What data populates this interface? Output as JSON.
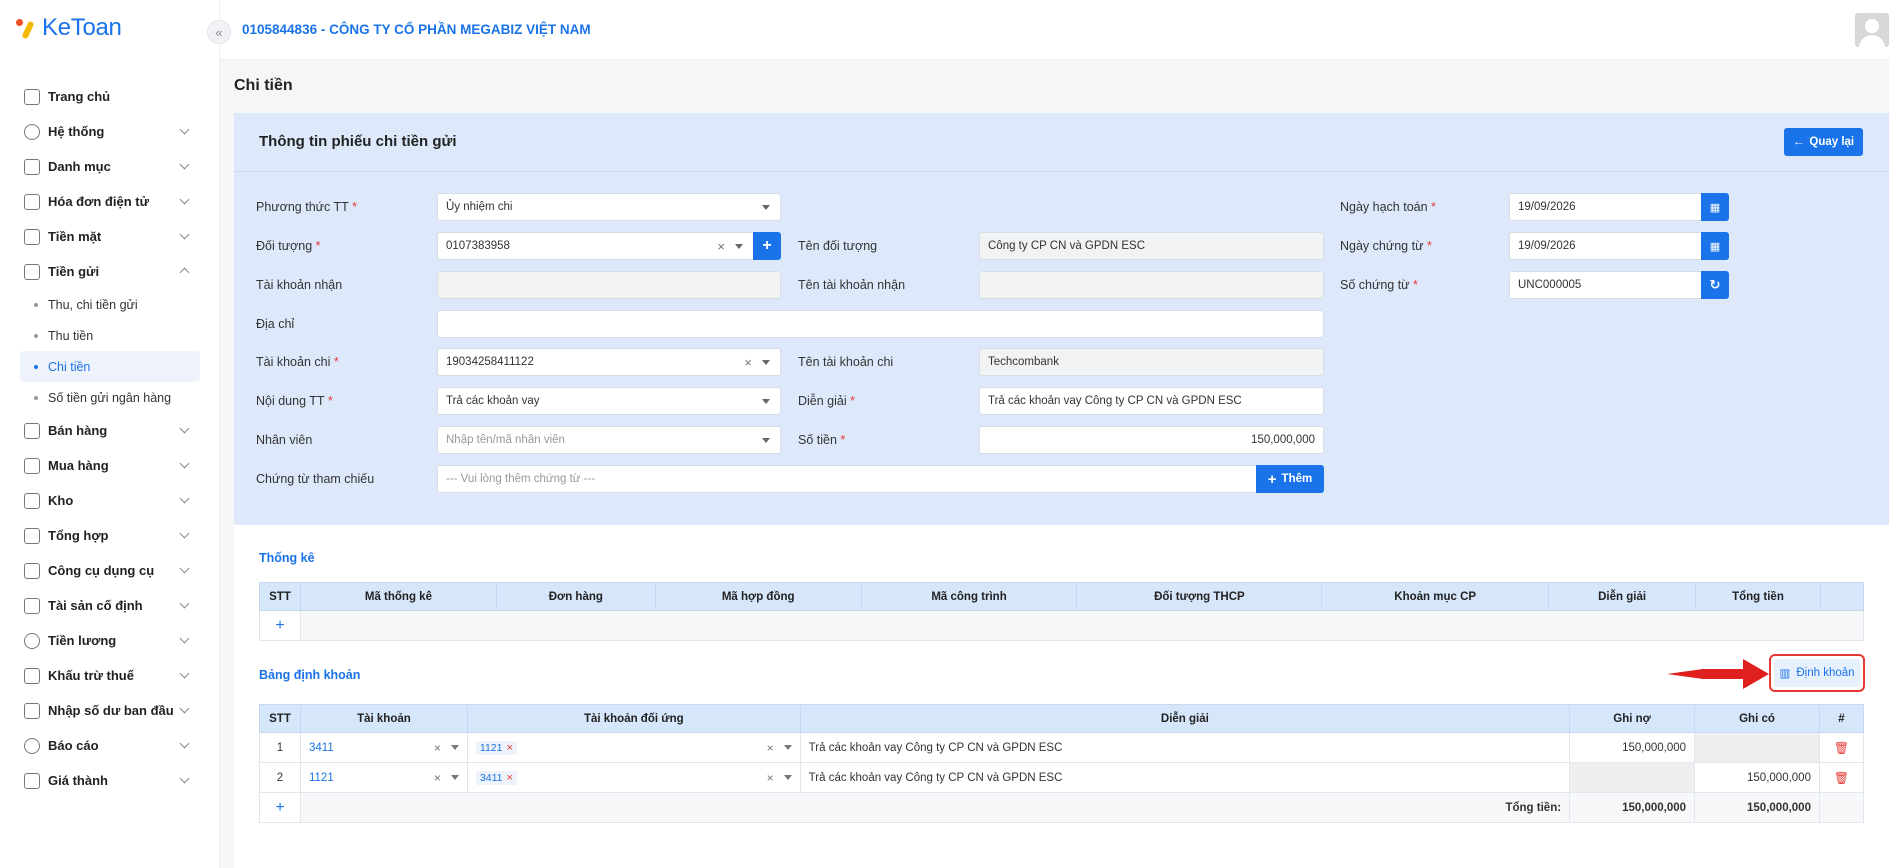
{
  "app": {
    "logo_text": "KeToan"
  },
  "header": {
    "company": "0105844836 - CÔNG TY CỔ PHẦN MEGABIZ VIỆT NAM"
  },
  "sidebar": {
    "items": [
      {
        "label": "Trang chủ",
        "icon": "home-icon"
      },
      {
        "label": "Hệ thống",
        "icon": "gear-icon"
      },
      {
        "label": "Danh mục",
        "icon": "grid-icon"
      },
      {
        "label": "Hóa đơn điện tử",
        "icon": "invoice-icon"
      },
      {
        "label": "Tiền mặt",
        "icon": "cash-icon"
      },
      {
        "label": "Tiền gửi",
        "icon": "bank-icon"
      },
      {
        "label": "Bán hàng",
        "icon": "sale-icon"
      },
      {
        "label": "Mua hàng",
        "icon": "purchase-icon"
      },
      {
        "label": "Kho",
        "icon": "warehouse-icon"
      },
      {
        "label": "Tổng hợp",
        "icon": "chart-icon"
      },
      {
        "label": "Công cụ dụng cụ",
        "icon": "tools-icon"
      },
      {
        "label": "Tài sản cố định",
        "icon": "asset-icon"
      },
      {
        "label": "Tiền lương",
        "icon": "salary-icon"
      },
      {
        "label": "Khấu trừ thuế",
        "icon": "tax-icon"
      },
      {
        "label": "Nhập số dư ban đầu",
        "icon": "balance-icon"
      },
      {
        "label": "Báo cáo",
        "icon": "report-icon"
      },
      {
        "label": "Giá thành",
        "icon": "cost-icon"
      }
    ],
    "subitems": [
      {
        "label": "Thu, chi tiền gửi"
      },
      {
        "label": "Thu tiền"
      },
      {
        "label": "Chi tiền"
      },
      {
        "label": "Số tiền gửi ngân hàng"
      }
    ]
  },
  "page": {
    "title": "Chi tiền"
  },
  "form": {
    "title": "Thông tin phiếu chi tiền gửi",
    "back_label": "Quay lại",
    "labels": {
      "phuong_thuc": "Phương thức TT",
      "doi_tuong": "Đối tượng",
      "tai_khoan_nhan": "Tài khoản nhận",
      "dia_chi": "Địa chỉ",
      "tai_khoan_chi": "Tài khoản chi",
      "noi_dung": "Nội dung TT",
      "nhan_vien": "Nhân viên",
      "chung_tu": "Chứng từ tham chiếu",
      "ten_doi_tuong": "Tên đối tượng",
      "ten_tk_nhan": "Tên tài khoản nhận",
      "ten_tk_chi": "Tên tài khoản chi",
      "dien_giai": "Diễn giải",
      "so_tien": "Số tiền",
      "ngay_hach_toan": "Ngày hạch toán",
      "ngay_chung_tu": "Ngày chứng từ",
      "so_chung_tu": "Số chứng từ"
    },
    "values": {
      "phuong_thuc": "Ủy nhiệm chi",
      "doi_tuong": "0107383958",
      "tai_khoan_chi": "19034258411122",
      "noi_dung": "Trả các khoản vay",
      "ten_doi_tuong": "Công ty CP CN và GPDN ESC",
      "ten_tk_chi": "Techcombank",
      "dien_giai": "Trả các khoản vay Công ty CP CN và GPDN ESC",
      "so_tien": "150,000,000",
      "ngay_hach_toan": "19/09/2026",
      "ngay_chung_tu": "19/09/2026",
      "so_chung_tu": "UNC000005"
    },
    "placeholders": {
      "nhan_vien": "Nhập tên/mã nhân viên",
      "chung_tu": "--- Vui lòng thêm chứng từ ---"
    },
    "add_label": "Thêm"
  },
  "thong_ke": {
    "title": "Thống kê",
    "columns": [
      "STT",
      "Mã thống kê",
      "Đơn hàng",
      "Mã hợp đồng",
      "Mã công trình",
      "Đối tượng THCP",
      "Khoản mục CP",
      "Diễn giải",
      "Tổng tiền"
    ]
  },
  "dinh_khoan": {
    "title": "Bảng định khoản",
    "button_label": "Định khoản",
    "columns": [
      "STT",
      "Tài khoản",
      "Tài khoản đối ứng",
      "Diễn giải",
      "Ghi nợ",
      "Ghi có",
      "#"
    ],
    "rows": [
      {
        "stt": "1",
        "tk": "3411",
        "tk_du": "1121",
        "dien_giai": "Trả các khoản vay Công ty CP CN và GPDN ESC",
        "no": "150,000,000",
        "co": ""
      },
      {
        "stt": "2",
        "tk": "1121",
        "tk_du": "3411",
        "dien_giai": "Trả các khoản vay Công ty CP CN và GPDN ESC",
        "no": "",
        "co": "150,000,000"
      }
    ],
    "total_label": "Tổng tiền:",
    "total_no": "150,000,000",
    "total_co": "150,000,000"
  },
  "colors": {
    "accent": "#1a73e8",
    "panel": "#dde9fb",
    "highlight": "#e53935"
  }
}
